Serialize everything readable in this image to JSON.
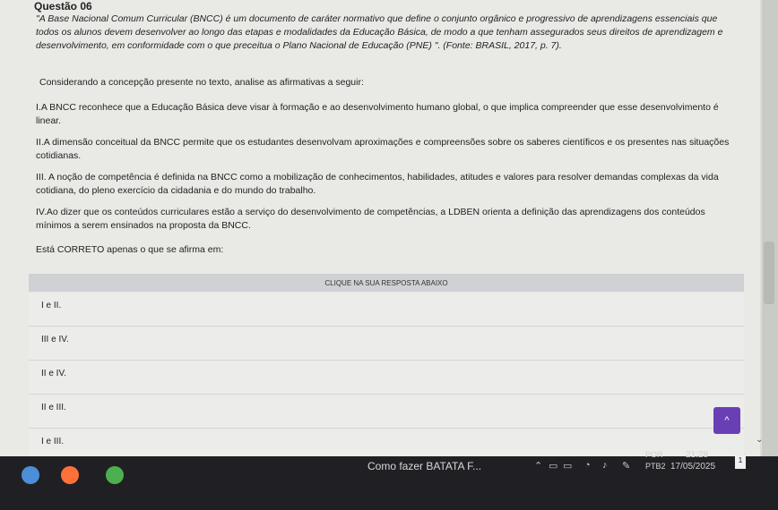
{
  "question": {
    "title": "Questão 06",
    "quote": "\"A Base Nacional Comum Curricular (BNCC) é um documento de caráter normativo que define o conjunto orgânico e progressivo de aprendizagens essenciais que todos os alunos devem desenvolver ao longo das etapas e modalidades da Educação Básica, de modo a que tenham assegurados seus direitos de aprendizagem e desenvolvimento, em conformidade com o que preceitua o Plano Nacional de Educação (PNE) \". (Fonte: BRASIL, 2017, p. 7).",
    "intro": "Considerando a concepção presente no texto, analise as afirmativas a seguir:",
    "affirmations": [
      "I.A BNCC reconhece que a Educação Básica deve visar à formação e ao desenvolvimento humano global, o que implica compreender que esse desenvolvimento é linear.",
      "II.A dimensão conceitual da BNCC permite que os estudantes desenvolvam aproximações e compreensões sobre os saberes científicos e os presentes nas situações cotidianas.",
      "III. A noção de competência é definida na BNCC como a mobilização de conhecimentos, habilidades, atitudes e valores para resolver demandas complexas da vida cotidiana, do pleno exercício da cidadania e do mundo do trabalho.",
      "IV.Ao dizer que os conteúdos curriculares estão a serviço do desenvolvimento de competências, a LDBEN orienta a definição das aprendizagens dos conteúdos mínimos a serem ensinados na proposta da BNCC."
    ],
    "ask": "Está CORRETO apenas o que se afirma em:",
    "answer_header": "CLIQUE NA SUA RESPOSTA ABAIXO",
    "options": [
      "I e II.",
      "III e IV.",
      "II e IV.",
      "II e III.",
      "I e III."
    ]
  },
  "ui": {
    "scroll_up_label": "^",
    "collapse_label": "⌄",
    "accent_color": "#6a3fb5"
  },
  "taskbar": {
    "media_title": "Como fazer BATATA F...",
    "language_1": "POR",
    "language_2": "PTB2",
    "time": "21:28",
    "date": "17/05/2025",
    "notification_count": "1"
  }
}
